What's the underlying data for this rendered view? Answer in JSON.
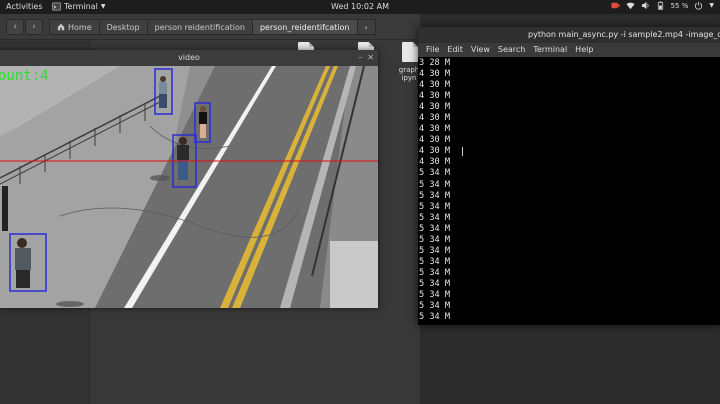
{
  "topbar": {
    "activities": "Activities",
    "app_menu": "Terminal",
    "clock": "Wed 10:02 AM",
    "battery": "55 %"
  },
  "files": {
    "breadcrumbs": [
      "Home",
      "Desktop",
      "person reidentification",
      "person_reidentifcation"
    ],
    "items": [
      {
        "label_line1": "graph",
        "label_line2": "ipyn"
      },
      {
        "label_line1": "cti",
        "label_line2": ""
      }
    ]
  },
  "video_window": {
    "title": "video",
    "overlay_text": "ount:4"
  },
  "terminal": {
    "title": "python main_async.py -i sample2.mp4 -image_dir im",
    "menu": [
      "File",
      "Edit",
      "View",
      "Search",
      "Terminal",
      "Help"
    ],
    "lines": [
      "3 28 M",
      "4 30 M",
      "4 30 M",
      "4 30 M",
      "4 30 M",
      "4 30 M",
      "4 30 M",
      "4 30 M",
      "4 30 M",
      "4 30 M",
      "5 34 M",
      "5 34 M",
      "5 34 M",
      "5 34 M",
      "5 34 M",
      "5 34 M",
      "5 34 M",
      "5 34 M",
      "5 34 M",
      "5 34 M",
      "5 34 M",
      "5 34 M",
      "5 34 M",
      "5 34 M"
    ]
  },
  "colors": {
    "detection_box": "#2a2cd6",
    "counting_line": "#e01010",
    "count_text": "#29e02a"
  }
}
